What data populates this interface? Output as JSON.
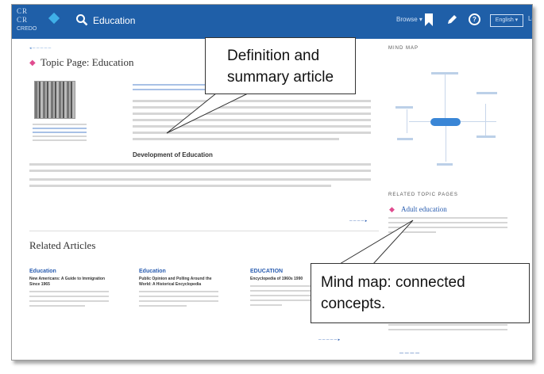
{
  "header": {
    "logo_lines": [
      "CR",
      "CR"
    ],
    "logo_word": "CREDO",
    "search_value": "Education",
    "browse_label": "Browse ▾",
    "language_label": "English ▾"
  },
  "callouts": {
    "definition": "Definition and summary article",
    "mindmap": "Mind map: connected concepts."
  },
  "topic": {
    "title": "Topic Page: Education",
    "subhead": "Development of Education"
  },
  "sidebar": {
    "related_topic_name": "Adult education"
  },
  "related": {
    "title": "Related Articles",
    "columns": [
      {
        "category": "Education",
        "subtitle": "New Americans: A Guide to Immigration Since 1965"
      },
      {
        "category": "Education",
        "subtitle": "Public Opinion and Polling Around the World: A Historical Encyclopedia"
      },
      {
        "category": "EDUCATION",
        "subtitle": "Encyclopedia of 1960s 1990"
      }
    ]
  },
  "colors": {
    "header_bg": "#1f5fa8",
    "link": "#2a5db0",
    "topic_icon": "#e04b8f"
  }
}
